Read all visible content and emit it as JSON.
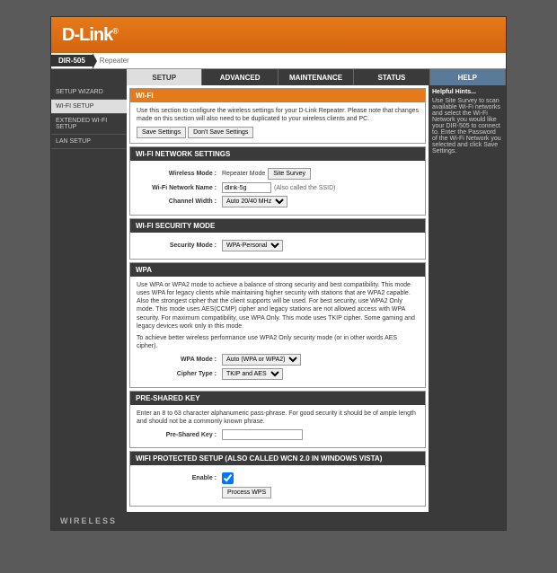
{
  "brand": "D-Link",
  "model": "DIR-505",
  "model_suffix": "Repeater",
  "tabs": {
    "setup": "SETUP",
    "advanced": "ADVANCED",
    "maintenance": "MAINTENANCE",
    "status": "STATUS",
    "help": "HELP"
  },
  "sidebar": {
    "wizard": "SETUP WIZARD",
    "wifi": "WI-FI SETUP",
    "ext": "EXTENDED WI-FI SETUP",
    "lan": "LAN SETUP"
  },
  "hints": {
    "title": "Helpful Hints...",
    "body": "Use Site Survey to scan available Wi-Fi networks and select the Wi-Fi Network you would like your DIR-505 to connect to. Enter the Password of the Wi-Fi Network you selected and click Save Settings."
  },
  "sect_wifi": {
    "title": "WI-FI",
    "desc": "Use this section to configure the wireless settings for your D-Link Repeater. Please note that changes made on this section will also need to be duplicated to your wireless clients and PC.",
    "save": "Save Settings",
    "dont": "Don't Save Settings"
  },
  "sect_net": {
    "title": "WI-FI NETWORK SETTINGS",
    "mode_lbl": "Wireless Mode :",
    "mode_val": "Repeater Mode",
    "survey": "Site Survey",
    "name_lbl": "Wi-Fi Network Name :",
    "name_val": "dlink-5g",
    "name_note": "(Also called the SSID)",
    "width_lbl": "Channel Width :",
    "width_val": "Auto 20/40 MHz"
  },
  "sect_sec": {
    "title": "WI-FI SECURITY MODE",
    "mode_lbl": "Security Mode :",
    "mode_val": "WPA-Personal"
  },
  "sect_wpa": {
    "title": "WPA",
    "p1": "Use WPA or WPA2 mode to achieve a balance of strong security and best compatibility. This mode uses WPA for legacy clients while maintaining higher security with stations that are WPA2 capable. Also the strongest cipher that the client supports will be used. For best security, use WPA2 Only mode. This mode uses AES(CCMP) cipher and legacy stations are not allowed access with WPA security. For maximum compatibility, use WPA Only. This mode uses TKIP cipher. Some gaming and legacy devices work only in this mode.",
    "p2": "To achieve better wireless performance use WPA2 Only security mode (or in other words AES cipher).",
    "mode_lbl": "WPA Mode :",
    "mode_val": "Auto (WPA or WPA2)",
    "cipher_lbl": "Cipher Type :",
    "cipher_val": "TKIP and AES"
  },
  "sect_psk": {
    "title": "PRE-SHARED KEY",
    "desc": "Enter an 8 to 63 character alphanumeric pass-phrase. For good security it should be of ample length and should not be a commonly known phrase.",
    "lbl": "Pre-Shared Key :",
    "val": ""
  },
  "sect_wps": {
    "title": "WIFI PROTECTED SETUP (ALSO CALLED WCN 2.0 IN WINDOWS VISTA)",
    "enable_lbl": "Enable :",
    "btn": "Process WPS"
  },
  "footer": "WIRELESS"
}
